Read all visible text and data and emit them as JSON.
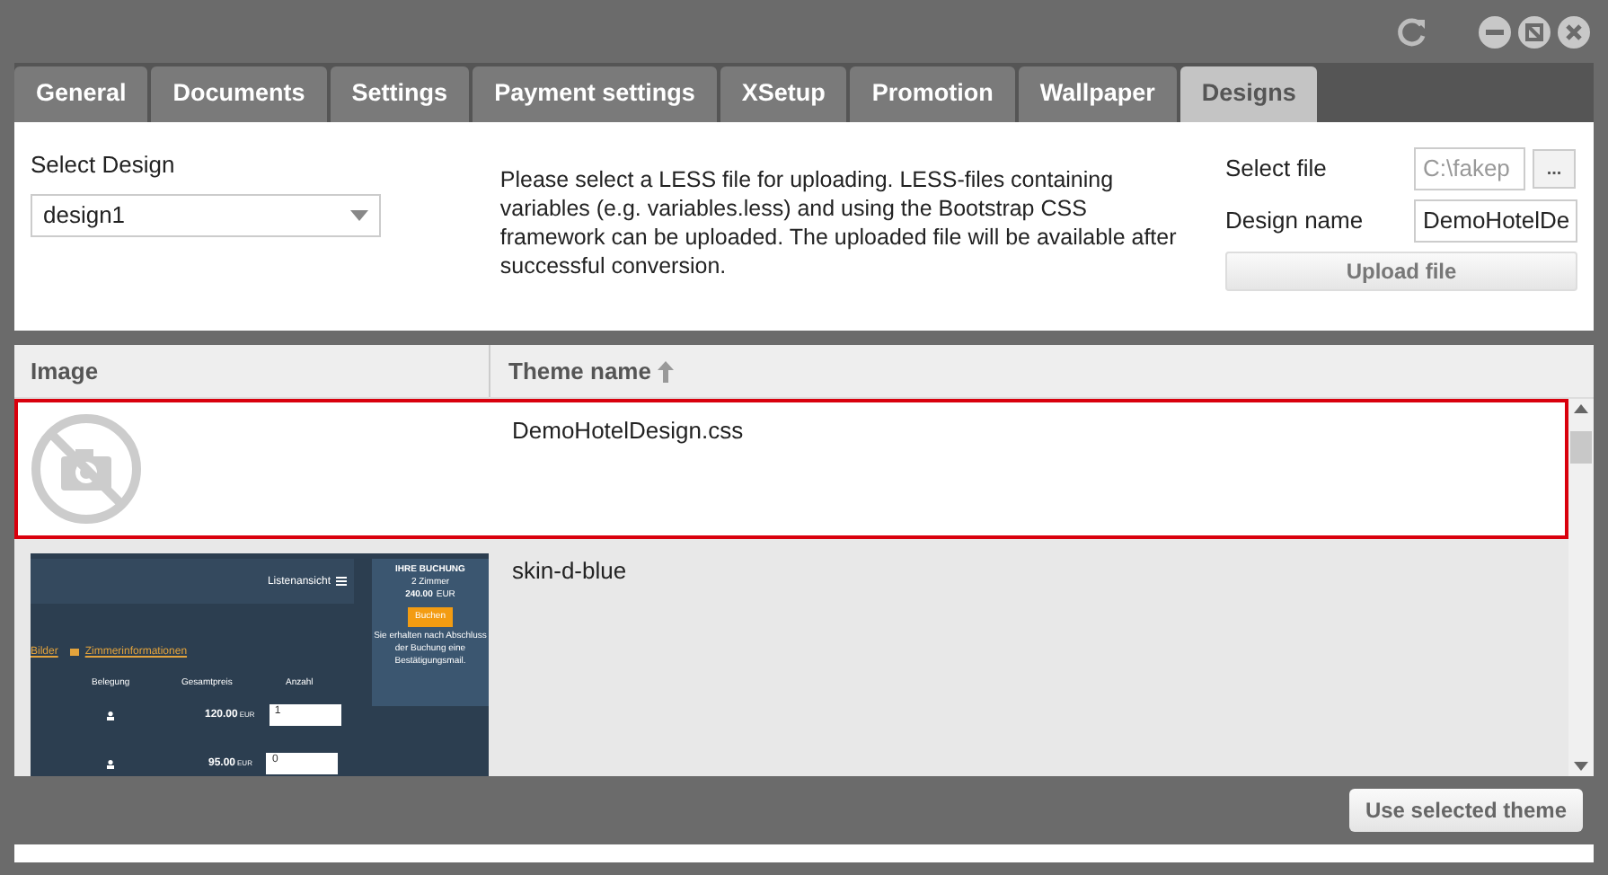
{
  "tabs": [
    {
      "label": "General",
      "selected": false
    },
    {
      "label": "Documents",
      "selected": false
    },
    {
      "label": "Settings",
      "selected": false
    },
    {
      "label": "Payment settings",
      "selected": false
    },
    {
      "label": "XSetup",
      "selected": false
    },
    {
      "label": "Promotion",
      "selected": false
    },
    {
      "label": "Wallpaper",
      "selected": false
    },
    {
      "label": "Designs",
      "selected": true
    }
  ],
  "select_design": {
    "label": "Select Design",
    "value": "design1"
  },
  "info_text": "Please select a LESS file for uploading. LESS-files containing variables (e.g. variables.less) and using the Bootstrap CSS framework can be uploaded. The uploaded file will be available after successful conversion.",
  "select_file": {
    "label": "Select file",
    "value": "C:\\fakep",
    "browse": "..."
  },
  "design_name": {
    "label": "Design name",
    "value": "DemoHotelDe"
  },
  "upload_button": "Upload file",
  "table": {
    "columns": [
      "Image",
      "Theme name"
    ],
    "rows": [
      {
        "image": {
          "kind": "placeholder"
        },
        "theme_name": "DemoHotelDesign.css",
        "selected": true
      },
      {
        "image": {
          "kind": "preview",
          "texts": {
            "view": "Listenansicht",
            "booking_title": "IHRE BUCHUNG",
            "rooms": "2 Zimmer",
            "total": "240.00",
            "total_cur": "EUR",
            "book": "Buchen",
            "note": "Sie erhalten nach Abschluss der Buchung eine Bestätigungsmail.",
            "link1": "Bilder",
            "link2": "Zimmerinformationen",
            "col1": "Belegung",
            "col2": "Gesamtpreis",
            "col3": "Anzahl",
            "price1": "120.00",
            "cur1": "EUR",
            "qty1": "1",
            "price2": "95.00",
            "cur2": "EUR",
            "qty2": "0"
          }
        },
        "theme_name": "skin-d-blue",
        "selected": false
      }
    ]
  },
  "use_button": "Use selected theme"
}
